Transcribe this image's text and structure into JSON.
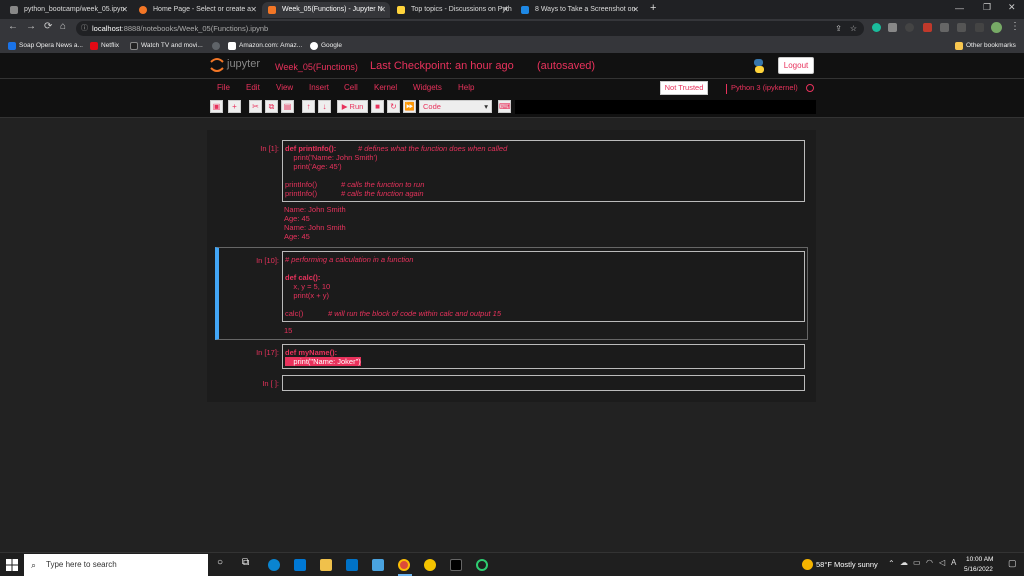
{
  "browser": {
    "tabs": [
      {
        "title": "python_bootcamp/week_05.ipyn",
        "active": false,
        "color": "#888888"
      },
      {
        "title": "Home Page - Select or create a",
        "active": false,
        "color": "#f37626"
      },
      {
        "title": "Week_05(Functions) - Jupyter N",
        "active": true,
        "color": "#f37626"
      },
      {
        "title": "Top topics - Discussions on Pyth",
        "active": false,
        "color": "#ffd43b"
      },
      {
        "title": "8 Ways to Take a Screenshot on",
        "active": false,
        "color": "#1e88e5"
      }
    ],
    "url_host": "localhost",
    "url_rest": ":8888/notebooks/Week_05(Functions).ipynb",
    "bookmarks": [
      {
        "label": "Soap Opera News a...",
        "color": "#1a73e8"
      },
      {
        "label": "Netflix",
        "color": "#e50914"
      },
      {
        "label": "Watch TV and movi...",
        "color": "#222222"
      },
      {
        "label": "",
        "color": "#5f6368"
      },
      {
        "label": "Amazon.com: Amaz...",
        "color": "#ffffff"
      },
      {
        "label": "Google",
        "color": "#ffffff"
      }
    ],
    "other_bookmarks": "Other bookmarks"
  },
  "jupyter": {
    "logo_text": "jupyter",
    "notebook_name": "Week_05(Functions)",
    "checkpoint": "Last Checkpoint: an hour ago",
    "autosaved": "(autosaved)",
    "logout": "Logout",
    "menu": [
      "File",
      "Edit",
      "View",
      "Insert",
      "Cell",
      "Kernel",
      "Widgets",
      "Help"
    ],
    "not_trusted": "Not Trusted",
    "kernel": "Python 3 (ipykernel)",
    "toolbar": {
      "run": "Run",
      "cell_type": "Code"
    },
    "accent": "#e8325c"
  },
  "cells": [
    {
      "prompt": "In [1]:",
      "lines": [
        {
          "code": "def printInfo():",
          "comment": "# defines what the function does when called"
        },
        {
          "code": "    print('Name: John Smith')",
          "comment": ""
        },
        {
          "code": "    print('Age: 45')",
          "comment": ""
        },
        {
          "code": "",
          "comment": ""
        },
        {
          "code": "printInfo()",
          "comment": "# calls the function to run"
        },
        {
          "code": "printInfo()",
          "comment": "# calls the function again"
        }
      ],
      "output": [
        "Name: John Smith",
        "Age: 45",
        "Name: John Smith",
        "Age: 45"
      ]
    },
    {
      "prompt": "In [10]:",
      "lines": [
        {
          "code": "",
          "comment": "# performing a calculation in a function"
        },
        {
          "code": "",
          "comment": ""
        },
        {
          "code": "def calc():",
          "comment": ""
        },
        {
          "code": "    x, y = 5, 10",
          "comment": ""
        },
        {
          "code": "    print(x + y)",
          "comment": ""
        },
        {
          "code": "",
          "comment": ""
        },
        {
          "code": "calc()",
          "comment": "# will run the block of code within calc and output 15"
        }
      ],
      "output": [
        "15"
      ]
    },
    {
      "prompt": "In [17]:",
      "lines": [
        {
          "code": "def myName():",
          "comment": ""
        },
        {
          "code": "    print(\"Name: Joker\")",
          "comment": ""
        }
      ],
      "output": []
    },
    {
      "prompt": "In [ ]:",
      "lines": [],
      "output": []
    }
  ],
  "taskbar": {
    "search_placeholder": "Type here to search",
    "weather": "58°F  Mostly sunny",
    "time": "10:00 AM",
    "date": "5/16/2022"
  }
}
